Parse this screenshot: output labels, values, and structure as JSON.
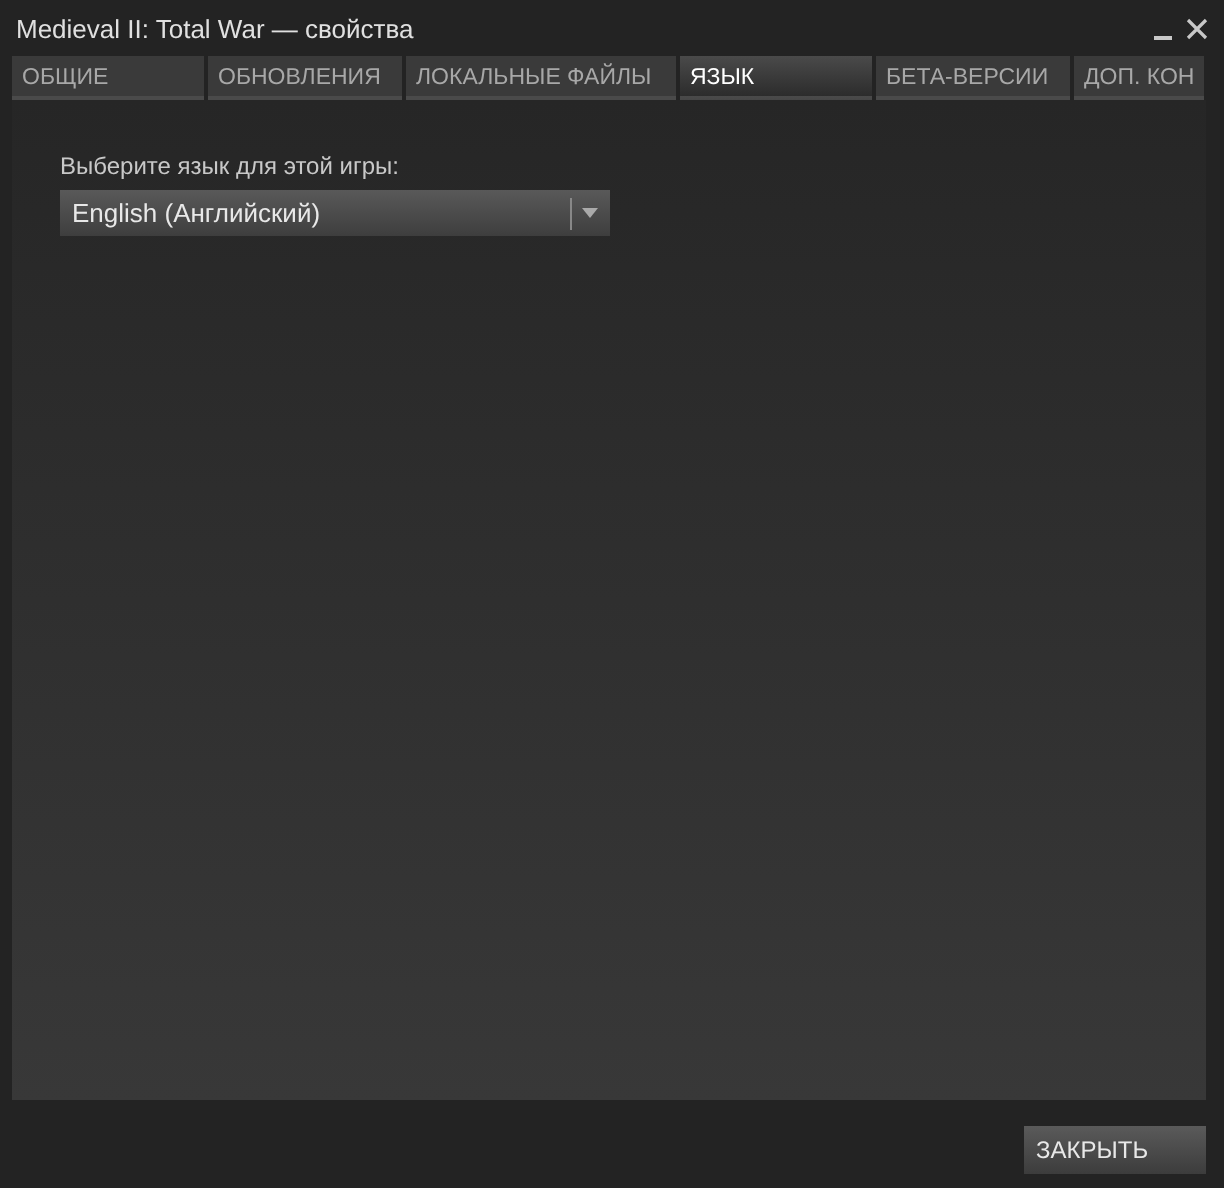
{
  "window": {
    "title": "Medieval II: Total War — свойства"
  },
  "tabs": [
    {
      "label": "ОБЩИЕ",
      "selected": false
    },
    {
      "label": "ОБНОВЛЕНИЯ",
      "selected": false
    },
    {
      "label": "ЛОКАЛЬНЫЕ ФАЙЛЫ",
      "selected": false
    },
    {
      "label": "ЯЗЫК",
      "selected": true
    },
    {
      "label": "БЕТА-ВЕРСИИ",
      "selected": false
    },
    {
      "label": "ДОП. КОН",
      "selected": false
    }
  ],
  "language": {
    "label": "Выберите язык для этой игры:",
    "value": "English (Английский)"
  },
  "buttons": [
    "ЗАКРЫТЬ"
  ]
}
